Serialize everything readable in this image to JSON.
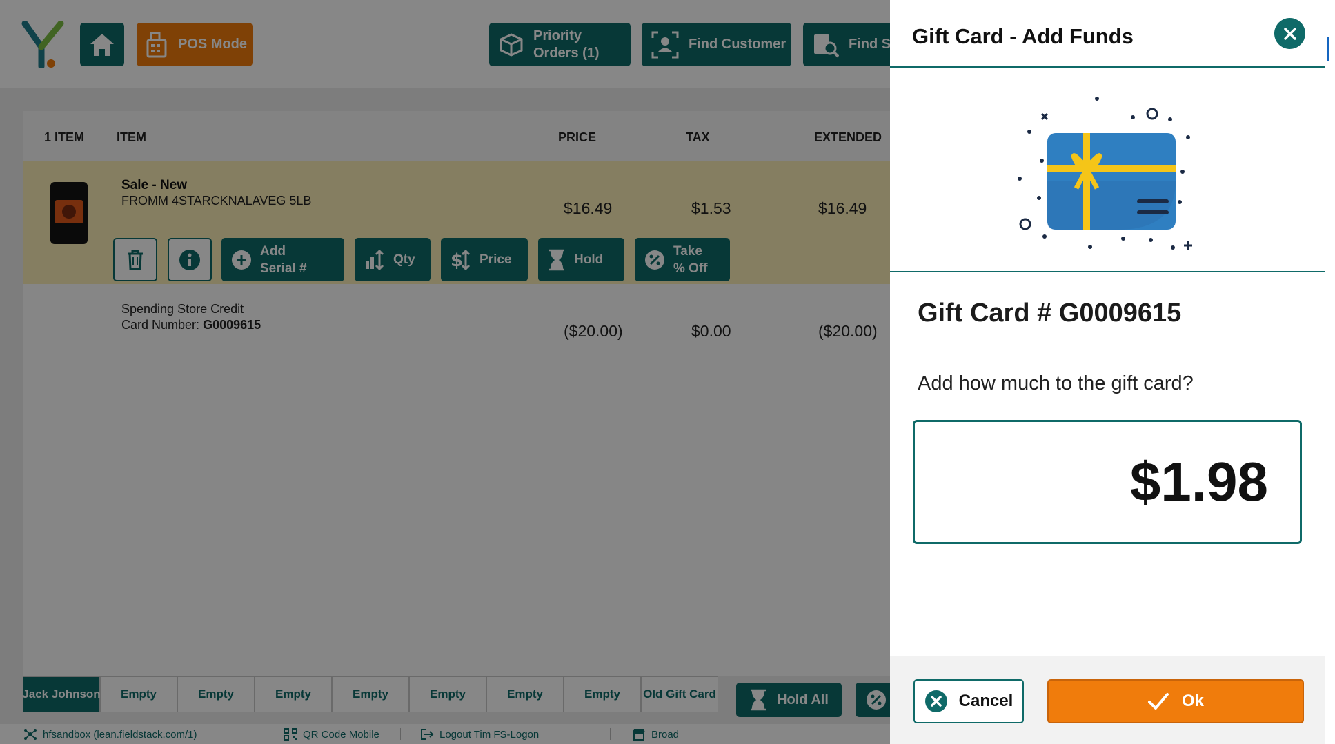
{
  "topbar": {
    "pos_mode_label": "POS Mode",
    "priority_orders_label_1": "Priority",
    "priority_orders_label_2": "Orders (1)",
    "find_customer_label": "Find Customer",
    "find_s_label": "Find S"
  },
  "grid": {
    "headers": {
      "count": "1 ITEM",
      "item": "ITEM",
      "price": "PRICE",
      "tax": "TAX",
      "extended": "EXTENDED"
    },
    "rows": [
      {
        "title": "Sale - New",
        "sub": "FROMM 4STARCKNALAVEG 5LB",
        "price": "$16.49",
        "tax": "$1.53",
        "extended": "$16.49"
      },
      {
        "title": "Spending Store Credit",
        "card_label": "Card Number:",
        "card_number": "G0009615",
        "price": "($20.00)",
        "tax": "$0.00",
        "extended": "($20.00)"
      }
    ],
    "actions": {
      "add_serial_1": "Add",
      "add_serial_2": "Serial #",
      "qty": "Qty",
      "price": "Price",
      "hold": "Hold",
      "take_off_1": "Take",
      "take_off_2": "% Off"
    }
  },
  "tabs": [
    "Jack Johnson",
    "Empty",
    "Empty",
    "Empty",
    "Empty",
    "Empty",
    "Empty",
    "Empty",
    "Old Gift Card"
  ],
  "hold_all_label": "Hold All",
  "status": {
    "sandbox": "hfsandbox (lean.fieldstack.com/1)",
    "qr": "QR Code Mobile",
    "logout": "Logout Tim FS-Logon",
    "store": "Broad"
  },
  "panel": {
    "title": "Gift Card - Add Funds",
    "card_heading": "Gift Card # G0009615",
    "prompt": "Add how much to the gift card?",
    "amount": "$1.98",
    "cancel_label": "Cancel",
    "ok_label": "Ok"
  },
  "colors": {
    "teal": "#0f6a68",
    "orange": "#f07c0c",
    "highlight_row": "#fbeeb8"
  }
}
